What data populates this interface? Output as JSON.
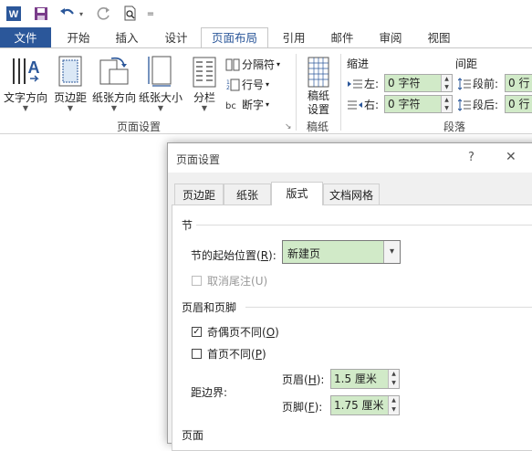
{
  "qat": {
    "icons": [
      "word-app-icon",
      "save-icon",
      "undo-icon",
      "redo-icon",
      "print-preview-icon",
      "customize-icon"
    ]
  },
  "tabs": [
    "文件",
    "开始",
    "插入",
    "设计",
    "页面布局",
    "引用",
    "邮件",
    "审阅",
    "视图"
  ],
  "ribbon": {
    "page_setup": {
      "text_direction": "文字方向",
      "margins": "页边距",
      "orientation": "纸张方向",
      "size": "纸张大小",
      "columns": "分栏",
      "breaks": "分隔符",
      "line_numbers": "行号",
      "hyphenation": "断字",
      "group": "页面设置"
    },
    "paper": {
      "label_line1": "稿纸",
      "label_line2": "设置",
      "group": "稿纸"
    },
    "paragraph": {
      "indent_title": "缩进",
      "spacing_title": "间距",
      "left_label": "左:",
      "right_label": "右:",
      "left_value": "0 字符",
      "right_value": "0 字符",
      "before_label": "段前:",
      "after_label": "段后:",
      "before_value": "0 行",
      "after_value": "0 行",
      "group": "段落"
    }
  },
  "dialog": {
    "title": "页面设置",
    "help": "?",
    "close": "✕",
    "tabs": [
      "页边距",
      "纸张",
      "版式",
      "文档网格"
    ],
    "section": {
      "title": "节",
      "start_label_prefix": "节的起始位置(",
      "start_label_key": "R",
      "start_label_suffix": "):",
      "start_value": "新建页",
      "suppress_endnotes_prefix": "取消尾注(",
      "suppress_endnotes_key": "U",
      "suppress_endnotes_suffix": ")"
    },
    "header_footer": {
      "title": "页眉和页脚",
      "odd_even_prefix": "奇偶页不同(",
      "odd_even_key": "O",
      "odd_even_suffix": ")",
      "odd_even_checked": true,
      "first_page_prefix": "首页不同(",
      "first_page_key": "P",
      "first_page_suffix": ")",
      "first_page_checked": false,
      "from_edge_label": "距边界:",
      "header_prefix": "页眉(",
      "header_key": "H",
      "header_suffix": "):",
      "header_value": "1.5 厘米",
      "footer_prefix": "页脚(",
      "footer_key": "F",
      "footer_suffix": "):",
      "footer_value": "1.75 厘米"
    },
    "page": {
      "title": "页面"
    }
  }
}
